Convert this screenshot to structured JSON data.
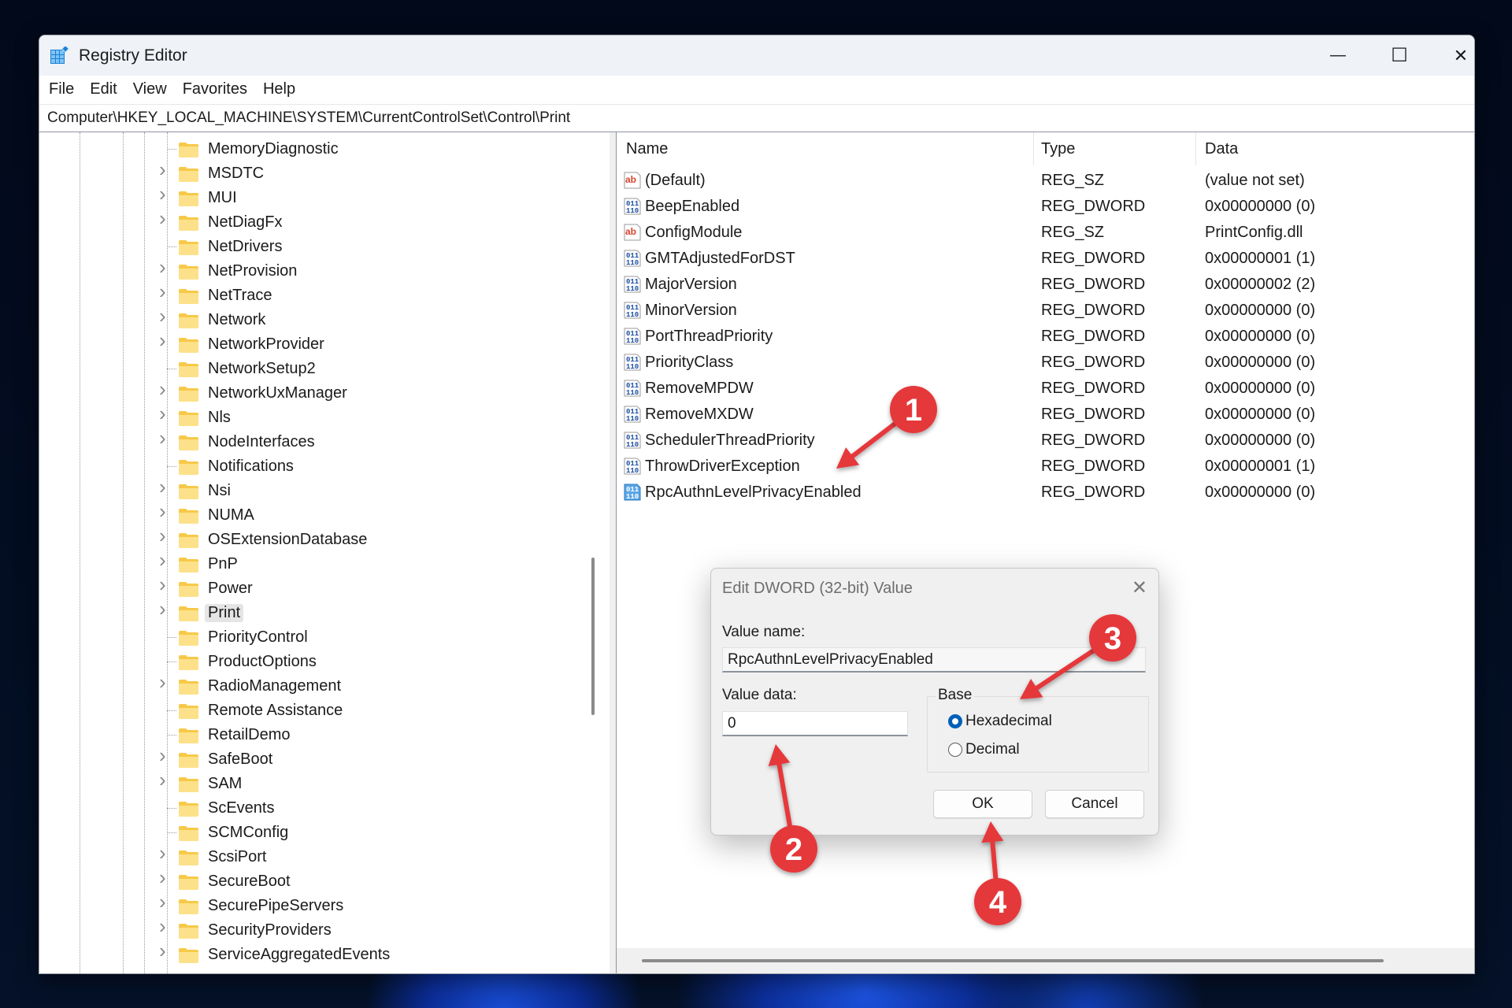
{
  "window": {
    "title": "Registry Editor",
    "controls": {
      "minimize": "—",
      "maximize": "☐",
      "close": "✕"
    }
  },
  "menu": [
    "File",
    "Edit",
    "View",
    "Favorites",
    "Help"
  ],
  "address": "Computer\\HKEY_LOCAL_MACHINE\\SYSTEM\\CurrentControlSet\\Control\\Print",
  "tree": {
    "selected": "Print",
    "items": [
      {
        "label": "MemoryDiagnostic",
        "expandable": false
      },
      {
        "label": "MSDTC",
        "expandable": true
      },
      {
        "label": "MUI",
        "expandable": true
      },
      {
        "label": "NetDiagFx",
        "expandable": true
      },
      {
        "label": "NetDrivers",
        "expandable": false
      },
      {
        "label": "NetProvision",
        "expandable": true
      },
      {
        "label": "NetTrace",
        "expandable": true
      },
      {
        "label": "Network",
        "expandable": true
      },
      {
        "label": "NetworkProvider",
        "expandable": true
      },
      {
        "label": "NetworkSetup2",
        "expandable": false
      },
      {
        "label": "NetworkUxManager",
        "expandable": true
      },
      {
        "label": "Nls",
        "expandable": true
      },
      {
        "label": "NodeInterfaces",
        "expandable": true
      },
      {
        "label": "Notifications",
        "expandable": false
      },
      {
        "label": "Nsi",
        "expandable": true
      },
      {
        "label": "NUMA",
        "expandable": true
      },
      {
        "label": "OSExtensionDatabase",
        "expandable": true
      },
      {
        "label": "PnP",
        "expandable": true
      },
      {
        "label": "Power",
        "expandable": true
      },
      {
        "label": "Print",
        "expandable": true
      },
      {
        "label": "PriorityControl",
        "expandable": false
      },
      {
        "label": "ProductOptions",
        "expandable": false
      },
      {
        "label": "RadioManagement",
        "expandable": true
      },
      {
        "label": "Remote Assistance",
        "expandable": false
      },
      {
        "label": "RetailDemo",
        "expandable": false
      },
      {
        "label": "SafeBoot",
        "expandable": true
      },
      {
        "label": "SAM",
        "expandable": true
      },
      {
        "label": "ScEvents",
        "expandable": false
      },
      {
        "label": "SCMConfig",
        "expandable": false
      },
      {
        "label": "ScsiPort",
        "expandable": true
      },
      {
        "label": "SecureBoot",
        "expandable": true
      },
      {
        "label": "SecurePipeServers",
        "expandable": true
      },
      {
        "label": "SecurityProviders",
        "expandable": true
      },
      {
        "label": "ServiceAggregatedEvents",
        "expandable": true
      }
    ]
  },
  "list": {
    "columns": [
      "Name",
      "Type",
      "Data"
    ],
    "rows": [
      {
        "icon": "string-value-icon",
        "name": "(Default)",
        "type": "REG_SZ",
        "data": "(value not set)"
      },
      {
        "icon": "dword-value-icon",
        "name": "BeepEnabled",
        "type": "REG_DWORD",
        "data": "0x00000000 (0)"
      },
      {
        "icon": "string-value-icon",
        "name": "ConfigModule",
        "type": "REG_SZ",
        "data": "PrintConfig.dll"
      },
      {
        "icon": "dword-value-icon",
        "name": "GMTAdjustedForDST",
        "type": "REG_DWORD",
        "data": "0x00000001 (1)"
      },
      {
        "icon": "dword-value-icon",
        "name": "MajorVersion",
        "type": "REG_DWORD",
        "data": "0x00000002 (2)"
      },
      {
        "icon": "dword-value-icon",
        "name": "MinorVersion",
        "type": "REG_DWORD",
        "data": "0x00000000 (0)"
      },
      {
        "icon": "dword-value-icon",
        "name": "PortThreadPriority",
        "type": "REG_DWORD",
        "data": "0x00000000 (0)"
      },
      {
        "icon": "dword-value-icon",
        "name": "PriorityClass",
        "type": "REG_DWORD",
        "data": "0x00000000 (0)"
      },
      {
        "icon": "dword-value-icon",
        "name": "RemoveMPDW",
        "type": "REG_DWORD",
        "data": "0x00000000 (0)"
      },
      {
        "icon": "dword-value-icon",
        "name": "RemoveMXDW",
        "type": "REG_DWORD",
        "data": "0x00000000 (0)"
      },
      {
        "icon": "dword-value-icon",
        "name": "SchedulerThreadPriority",
        "type": "REG_DWORD",
        "data": "0x00000000 (0)"
      },
      {
        "icon": "dword-value-icon",
        "name": "ThrowDriverException",
        "type": "REG_DWORD",
        "data": "0x00000001 (1)"
      },
      {
        "icon": "dword-value-icon",
        "name": "RpcAuthnLevelPrivacyEnabled",
        "type": "REG_DWORD",
        "data": "0x00000000 (0)",
        "highlighted": true
      }
    ]
  },
  "dialog": {
    "title": "Edit DWORD (32-bit) Value",
    "close": "✕",
    "value_name_label": "Value name:",
    "value_name": "RpcAuthnLevelPrivacyEnabled",
    "value_data_label": "Value data:",
    "value_data": "0",
    "base_label": "Base",
    "base_options": [
      {
        "label": "Hexadecimal",
        "checked": true
      },
      {
        "label": "Decimal",
        "checked": false
      }
    ],
    "ok": "OK",
    "cancel": "Cancel"
  },
  "annotations": {
    "color": "#e5383b",
    "badges": [
      "1",
      "2",
      "3",
      "4"
    ]
  }
}
